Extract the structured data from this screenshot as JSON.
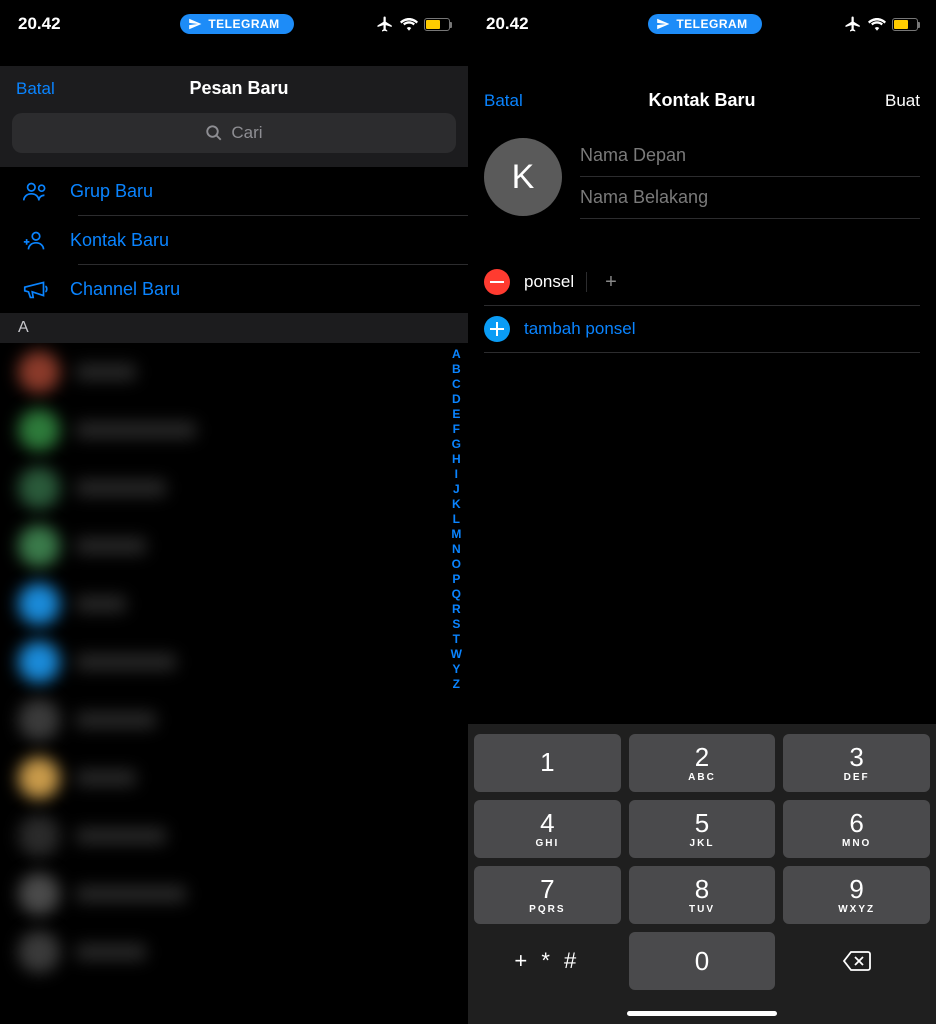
{
  "status": {
    "time": "20.42",
    "pill": "TELEGRAM",
    "battery_pct": 55
  },
  "left": {
    "cancel": "Batal",
    "title": "Pesan Baru",
    "search_placeholder": "Cari",
    "menu": {
      "new_group": "Grup Baru",
      "new_contact": "Kontak Baru",
      "new_channel": "Channel Baru"
    },
    "section_a": "A",
    "index_letters": [
      "A",
      "B",
      "C",
      "D",
      "E",
      "F",
      "G",
      "H",
      "I",
      "J",
      "K",
      "L",
      "M",
      "N",
      "O",
      "P",
      "Q",
      "R",
      "S",
      "T",
      "W",
      "Y",
      "Z"
    ]
  },
  "right": {
    "cancel": "Batal",
    "title": "Kontak Baru",
    "create": "Buat",
    "avatar_initial": "K",
    "first_name_placeholder": "Nama Depan",
    "last_name_placeholder": "Nama Belakang",
    "phone_type": "ponsel",
    "phone_plus": "+",
    "add_phone": "tambah ponsel",
    "keypad": [
      {
        "n": "1",
        "s": ""
      },
      {
        "n": "2",
        "s": "ABC"
      },
      {
        "n": "3",
        "s": "DEF"
      },
      {
        "n": "4",
        "s": "GHI"
      },
      {
        "n": "5",
        "s": "JKL"
      },
      {
        "n": "6",
        "s": "MNO"
      },
      {
        "n": "7",
        "s": "PQRS"
      },
      {
        "n": "8",
        "s": "TUV"
      },
      {
        "n": "9",
        "s": "WXYZ"
      }
    ],
    "symbols": "+ * #",
    "zero": "0"
  }
}
